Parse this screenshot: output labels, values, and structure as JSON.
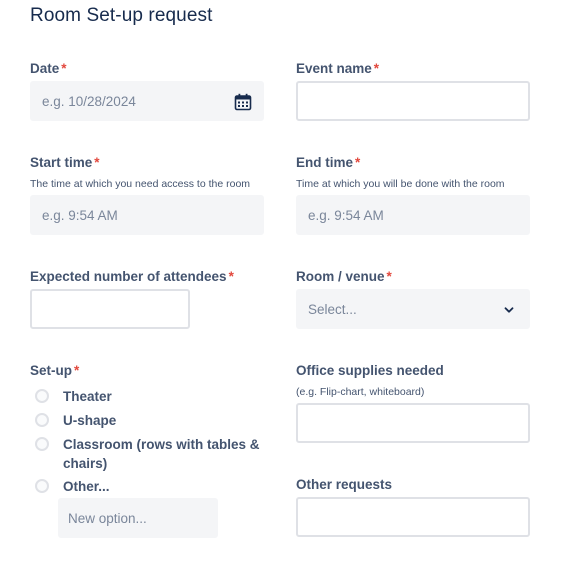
{
  "form": {
    "title": "Room Set-up request"
  },
  "fields": {
    "date": {
      "label": "Date",
      "required_mark": "*",
      "placeholder": "e.g. 10/28/2024",
      "icon": "calendar-icon"
    },
    "event_name": {
      "label": "Event name",
      "required_mark": "*",
      "value": ""
    },
    "start_time": {
      "label": "Start time",
      "required_mark": "*",
      "help": "The time at which you need access to the room",
      "placeholder": "e.g. 9:54 AM"
    },
    "end_time": {
      "label": "End time",
      "required_mark": "*",
      "help": "Time at which you will be done with the room",
      "placeholder": "e.g. 9:54 AM"
    },
    "attendees": {
      "label": "Expected number of attendees",
      "required_mark": "*",
      "value": ""
    },
    "room": {
      "label": "Room / venue",
      "required_mark": "*",
      "placeholder": "Select...",
      "icon": "chevron-down-icon"
    },
    "setup": {
      "label": "Set-up",
      "required_mark": "*",
      "options": [
        "Theater",
        "U-shape",
        "Classroom (rows with tables & chairs)",
        "Other..."
      ],
      "new_option_placeholder": "New option..."
    },
    "office_supplies": {
      "label": "Office supplies needed",
      "help": "(e.g. Flip-chart, whiteboard)",
      "value": ""
    },
    "other_requests": {
      "label": "Other requests",
      "value": ""
    }
  },
  "colors": {
    "label": "#44546f",
    "required": "#e2483d",
    "input_fill": "#f4f5f7",
    "input_border": "#dfe1e6",
    "icon": "#172b4d"
  }
}
